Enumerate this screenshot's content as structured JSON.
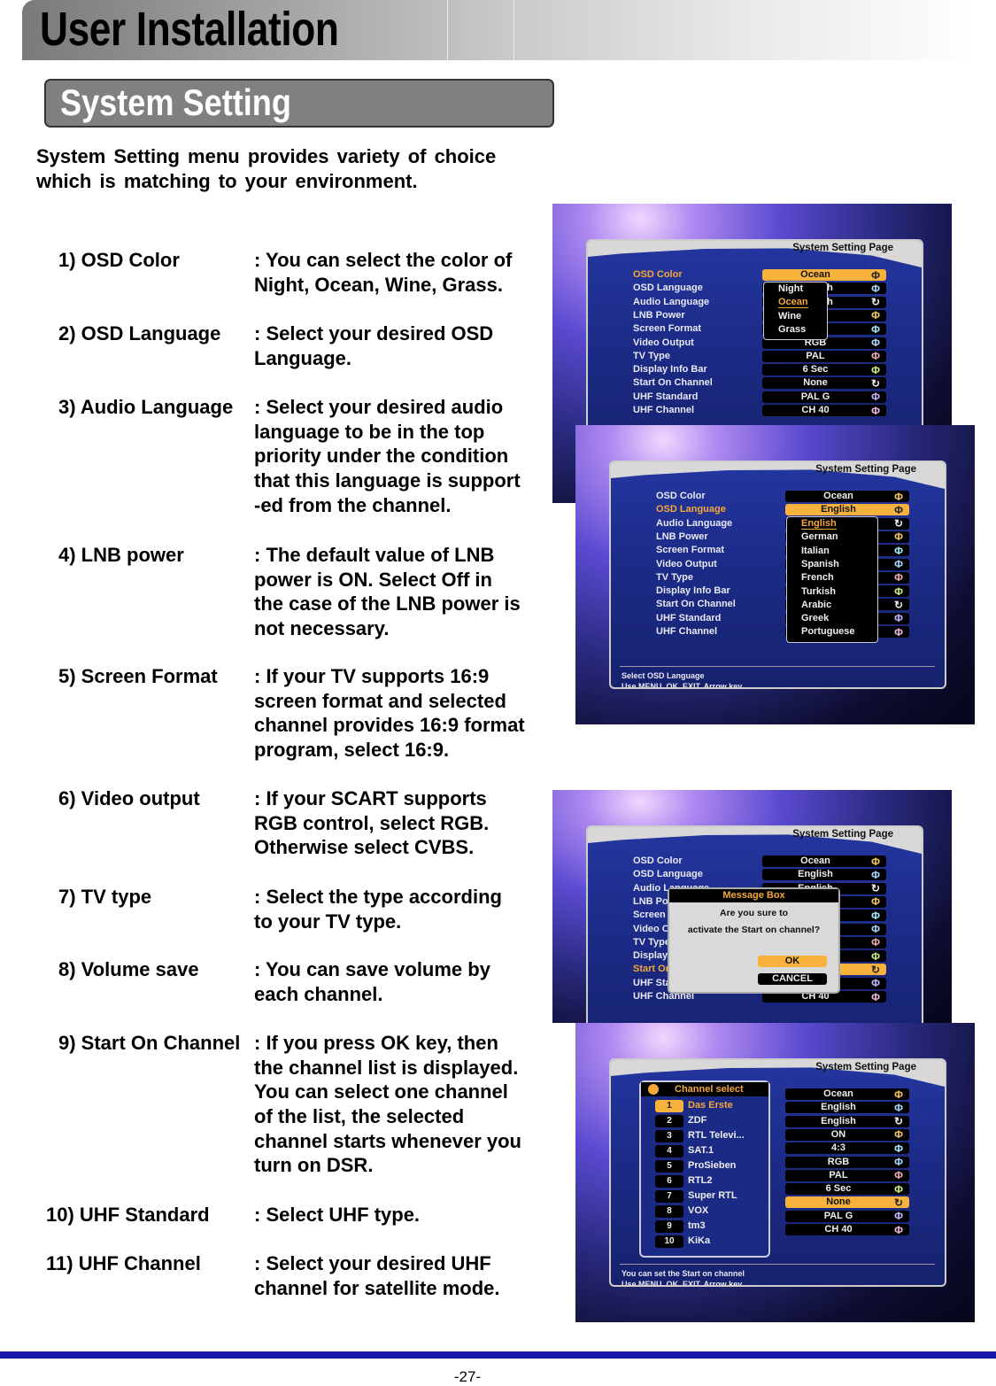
{
  "header": {
    "title": "User Installation"
  },
  "section": {
    "title": "System Setting"
  },
  "intro": [
    "System  Setting  menu  provides  variety  of  choice",
    "which is matching to your environment."
  ],
  "items": [
    {
      "label": "1) OSD Color",
      "desc": [
        ": You can select the color of",
        "Night, Ocean, Wine, Grass."
      ]
    },
    {
      "label": "2) OSD Language",
      "desc": [
        ": Select your desired OSD",
        "Language."
      ]
    },
    {
      "label": "3) Audio Language",
      "desc": [
        ": Select your desired audio",
        "language to be in the top",
        "priority under the condition",
        "that this language is  support",
        "-ed from the channel."
      ]
    },
    {
      "label": "4) LNB power",
      "desc": [
        ": The default value of LNB",
        "power is ON. Select Off in",
        "the case of the LNB power is",
        "not necessary."
      ]
    },
    {
      "label": "5) Screen Format",
      "desc": [
        ": If your TV supports 16:9",
        "screen format and selected",
        "channel provides 16:9 format",
        "program, select 16:9."
      ]
    },
    {
      "label": "6) Video output",
      "desc": [
        ": If your SCART supports",
        "RGB control, select RGB.",
        "Otherwise select CVBS."
      ]
    },
    {
      "label": "7) TV type",
      "desc": [
        ": Select the type according",
        "to your TV type."
      ]
    },
    {
      "label": "8) Volume save",
      "desc": [
        ": You can save volume by",
        "each channel."
      ]
    },
    {
      "label": "9) Start On Channel",
      "desc": [
        ": If you press OK key, then",
        "the channel list is displayed.",
        "You can select one channel",
        "of the list, the selected",
        "channel starts whenever you",
        "turn on DSR."
      ]
    },
    {
      "label": "10) UHF Standard",
      "desc": [
        ":  Select UHF type."
      ]
    },
    {
      "label": "11) UHF Channel",
      "desc": [
        ":  Select your desired UHF",
        "channel for satellite mode."
      ]
    }
  ],
  "screens": [
    {
      "title": "System Setting Page",
      "labels": [
        "OSD Color",
        "OSD Language",
        "Audio Language",
        "LNB Power",
        "Screen Format",
        "Video Output",
        "TV Type",
        "Display Info Bar",
        "Start On Channel",
        "UHF Standard",
        "UHF Channel"
      ],
      "values": [
        "Ocean",
        "English",
        "English",
        "",
        "",
        "RGB",
        "PAL",
        "6 Sec",
        "None",
        "PAL G",
        "CH 40"
      ],
      "highlight": 0,
      "popup": {
        "type": "list",
        "items": [
          "Night",
          "Ocean",
          "Wine",
          "Grass"
        ],
        "selected": 1
      },
      "footer": []
    },
    {
      "title": "System Setting Page",
      "labels": [
        "OSD Color",
        "OSD Language",
        "Audio Language",
        "LNB Power",
        "Screen Format",
        "Video Output",
        "TV Type",
        "Display Info Bar",
        "Start On Channel",
        "UHF Standard",
        "UHF Channel"
      ],
      "values": [
        "Ocean",
        "English",
        "",
        "",
        "",
        "",
        "",
        "",
        "",
        "",
        ""
      ],
      "highlight": 1,
      "popup": {
        "type": "list",
        "items": [
          "English",
          "German",
          "Italian",
          "Spanish",
          "French",
          "Turkish",
          "Arabic",
          "Greek",
          "Portuguese"
        ],
        "selected": 0
      },
      "footer": [
        "Select OSD Language",
        "Use MENU, OK, EXIT, Arrow key."
      ]
    },
    {
      "title": "System Setting Page",
      "labels": [
        "OSD Color",
        "OSD Language",
        "Audio Language",
        "LNB Power",
        "Screen Format",
        "Video Output",
        "TV Type",
        "Display Info Bar",
        "Start On Channel",
        "UHF Standard",
        "UHF Channel"
      ],
      "values": [
        "Ocean",
        "English",
        "English",
        "",
        "",
        "",
        "",
        "",
        "",
        "",
        "CH 40"
      ],
      "highlight": 8,
      "popup": {
        "type": "message",
        "title": "Message Box",
        "lines": [
          "Are you sure to",
          "activate the Start on channel?"
        ],
        "ok": "OK",
        "cancel": "CANCEL"
      },
      "footer": []
    },
    {
      "title": "System Setting Page",
      "labels": [],
      "values": [
        "Ocean",
        "English",
        "English",
        "ON",
        "4:3",
        "RGB",
        "PAL",
        "6 Sec",
        "None",
        "PAL G",
        "CH 40"
      ],
      "highlight": 8,
      "popup": {
        "type": "channels",
        "title": "Channel select",
        "channels": [
          {
            "num": "1",
            "name": "Das Erste"
          },
          {
            "num": "2",
            "name": "ZDF"
          },
          {
            "num": "3",
            "name": "RTL Televi..."
          },
          {
            "num": "4",
            "name": "SAT.1"
          },
          {
            "num": "5",
            "name": "ProSieben"
          },
          {
            "num": "6",
            "name": "RTL2"
          },
          {
            "num": "7",
            "name": "Super RTL"
          },
          {
            "num": "8",
            "name": "VOX"
          },
          {
            "num": "9",
            "name": "tm3"
          },
          {
            "num": "10",
            "name": "KiKa"
          }
        ],
        "selected": 0
      },
      "footer": [
        "You can set the Start on channel",
        "Use MENU, OK, EXIT, Arrow key."
      ]
    }
  ],
  "colors": {
    "highlight": "#f6b23a",
    "bottom_rule": "#1818a8",
    "section_bg": "#808080"
  },
  "footer": {
    "page_number": "-27-"
  }
}
